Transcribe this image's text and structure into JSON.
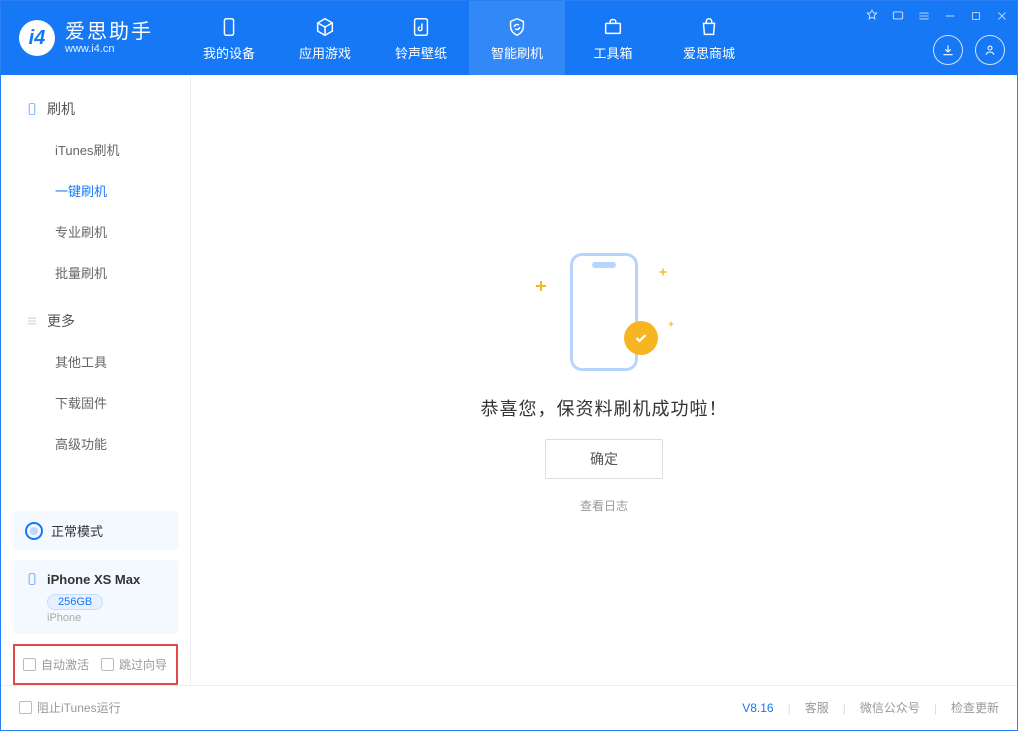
{
  "app": {
    "title": "爱思助手",
    "subtitle": "www.i4.cn"
  },
  "nav": [
    {
      "label": "我的设备"
    },
    {
      "label": "应用游戏"
    },
    {
      "label": "铃声壁纸"
    },
    {
      "label": "智能刷机"
    },
    {
      "label": "工具箱"
    },
    {
      "label": "爱思商城"
    }
  ],
  "sidebar": {
    "section1": {
      "title": "刷机",
      "items": [
        "iTunes刷机",
        "一键刷机",
        "专业刷机",
        "批量刷机"
      ]
    },
    "section2": {
      "title": "更多",
      "items": [
        "其他工具",
        "下载固件",
        "高级功能"
      ]
    }
  },
  "device": {
    "mode": "正常模式",
    "name": "iPhone XS Max",
    "capacity": "256GB",
    "type": "iPhone"
  },
  "options": {
    "auto_activate": "自动激活",
    "skip_guide": "跳过向导"
  },
  "main": {
    "message": "恭喜您，保资料刷机成功啦！",
    "ok": "确定",
    "view_log": "查看日志"
  },
  "footer": {
    "block_itunes": "阻止iTunes运行",
    "version": "V8.16",
    "service": "客服",
    "wechat": "微信公众号",
    "update": "检查更新"
  }
}
